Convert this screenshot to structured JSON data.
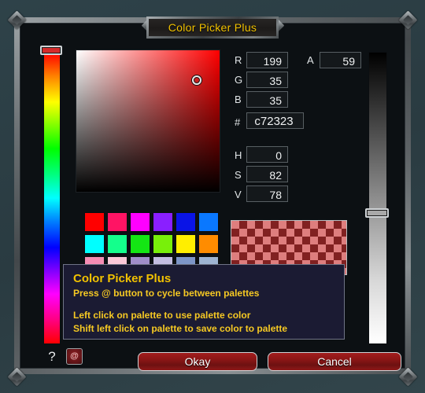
{
  "window": {
    "title": "Color Picker Plus"
  },
  "color": {
    "hex_display": "c72323",
    "css": "#c72323",
    "alpha_percent": 59
  },
  "channels": {
    "rgb": [
      {
        "label": "R",
        "value": "199"
      },
      {
        "label": "G",
        "value": "35"
      },
      {
        "label": "B",
        "value": "35"
      }
    ],
    "alpha": {
      "label": "A",
      "value": "59"
    },
    "hex": {
      "label": "#",
      "value": "c72323"
    },
    "hsv": [
      {
        "label": "H",
        "value": "0"
      },
      {
        "label": "S",
        "value": "82"
      },
      {
        "label": "V",
        "value": "78"
      }
    ]
  },
  "palette": {
    "rows": [
      [
        "#ff0000",
        "#ff1464",
        "#ff00ff",
        "#8a1fff",
        "#0a14e6",
        "#0a78ff"
      ],
      [
        "#00ffff",
        "#14ff8c",
        "#14e614",
        "#78f00a",
        "#ffee00",
        "#ff8c00"
      ],
      [
        "#f58cb4",
        "#fac8d7",
        "#a08ec8",
        "#c3bee1",
        "#7d96c8",
        "#9eb4d2"
      ]
    ]
  },
  "tooltip": {
    "title": "Color Picker Plus",
    "subtitle": "Press @ button to cycle between palettes",
    "line1": "Left click on palette to use palette color",
    "line2": "Shift left click on palette to save color to palette"
  },
  "buttons": {
    "help": "?",
    "at": "@",
    "okay": "Okay",
    "cancel": "Cancel"
  },
  "colors": {
    "title_gold": "#f2c200",
    "tooltip_bg": "#1b1b33",
    "button_red": "#8a1616",
    "frame_bg": "#0c1013",
    "page_bg": "#2c3e44"
  }
}
